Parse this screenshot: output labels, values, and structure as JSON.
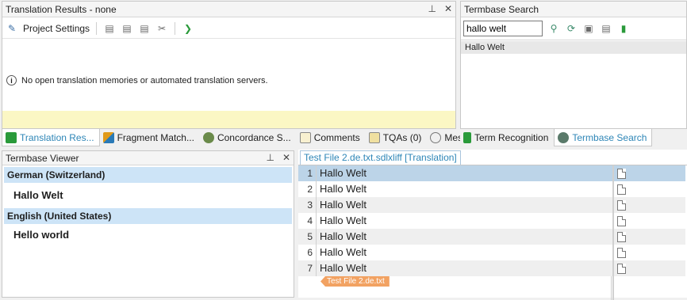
{
  "translation_results": {
    "title": "Translation Results - none",
    "project_settings_label": "Project Settings",
    "message": "No open translation memories or automated translation servers."
  },
  "termbase_search": {
    "title": "Termbase Search",
    "query": "hallo welt",
    "result": "Hallo Welt"
  },
  "bottom_tabs_left": [
    {
      "label": "Translation Res..."
    },
    {
      "label": "Fragment Match..."
    },
    {
      "label": "Concordance S..."
    },
    {
      "label": "Comments"
    },
    {
      "label": "TQAs (0)"
    },
    {
      "label": "Messages"
    }
  ],
  "bottom_tabs_right": [
    {
      "label": "Term Recognition"
    },
    {
      "label": "Termbase Search"
    }
  ],
  "termbase_viewer": {
    "title": "Termbase Viewer",
    "languages": [
      {
        "name": "German (Switzerland)",
        "term": "Hallo Welt"
      },
      {
        "name": "English (United States)",
        "term": "Hello world"
      }
    ]
  },
  "editor": {
    "tab_label": "Test File 2.de.txt.sdlxliff [Translation]",
    "rows": [
      {
        "num": "1",
        "text": "Hallo Welt"
      },
      {
        "num": "2",
        "text": "Hallo Welt"
      },
      {
        "num": "3",
        "text": "Hallo Welt"
      },
      {
        "num": "4",
        "text": "Hallo Welt"
      },
      {
        "num": "5",
        "text": "Hallo Welt"
      },
      {
        "num": "6",
        "text": "Hallo Welt"
      },
      {
        "num": "7",
        "text": "Hallo Welt"
      }
    ],
    "file_tag": "Test File 2.de.txt"
  },
  "colors": {
    "accent": "#2e86b7",
    "selection": "#bcd4e8",
    "lang_header": "#cde4f7",
    "yellow_bar": "#fbf7c4",
    "file_tag": "#f2a262"
  },
  "icons": {
    "pin": "pin-icon",
    "close": "close-icon",
    "info": "info-icon",
    "run": "play-icon"
  }
}
